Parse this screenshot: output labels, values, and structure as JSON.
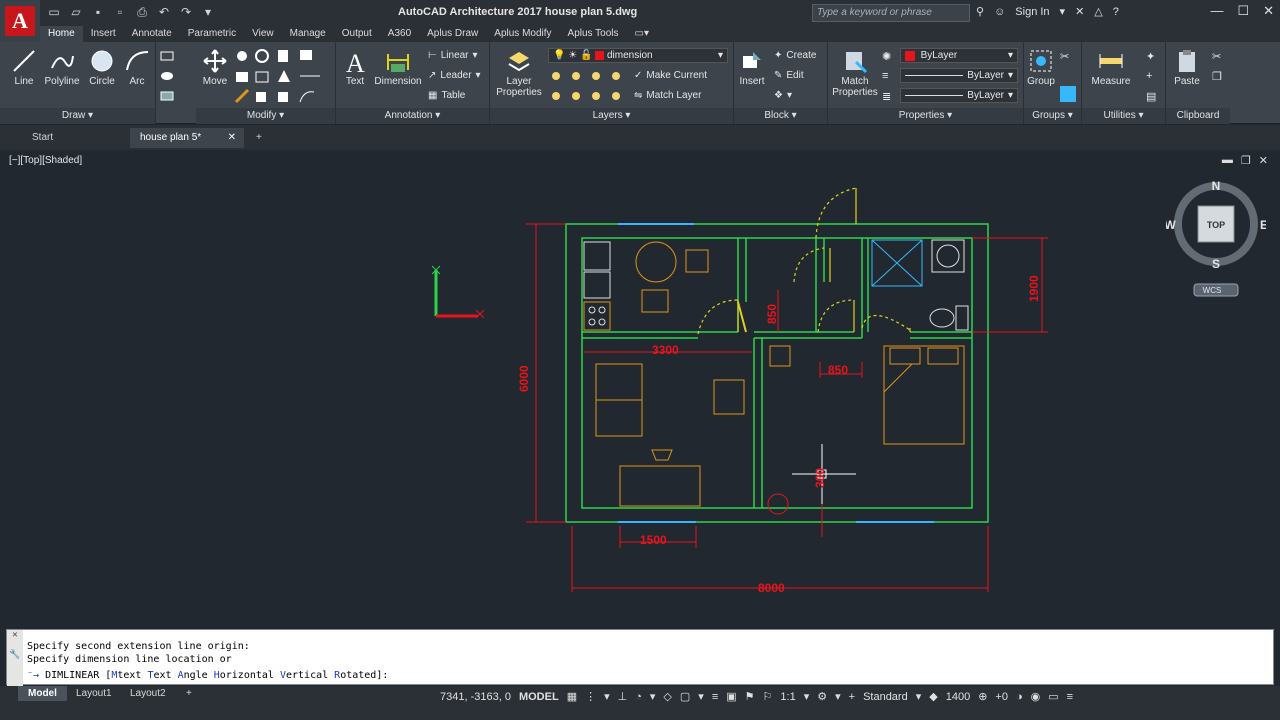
{
  "window": {
    "title": "AutoCAD Architecture 2017   house plan 5.dwg",
    "search_placeholder": "Type a keyword or phrase",
    "sign_in": "Sign In"
  },
  "ribbon_tabs": [
    "Home",
    "Insert",
    "Annotate",
    "Parametric",
    "View",
    "Manage",
    "Output",
    "A360",
    "Aplus Draw",
    "Aplus Modify",
    "Aplus Tools"
  ],
  "ribbon": {
    "draw": {
      "title": "Draw",
      "line": "Line",
      "polyline": "Polyline",
      "circle": "Circle",
      "arc": "Arc"
    },
    "modify": {
      "title": "Modify",
      "move": "Move"
    },
    "annotation": {
      "title": "Annotation",
      "text": "Text",
      "dimension": "Dimension",
      "linear": "Linear",
      "leader": "Leader",
      "table": "Table"
    },
    "layers": {
      "title": "Layers",
      "layer_properties_1": "Layer",
      "layer_properties_2": "Properties",
      "current_layer": "dimension",
      "make_current": "Make Current",
      "match_layer": "Match Layer"
    },
    "block": {
      "title": "Block",
      "insert": "Insert",
      "create": "Create",
      "edit": "Edit"
    },
    "properties": {
      "title": "Properties",
      "match_1": "Match",
      "match_2": "Properties",
      "color": "ByLayer",
      "linetype": "ByLayer",
      "lineweight": "ByLayer"
    },
    "groups": {
      "title": "Groups",
      "group": "Group"
    },
    "utilities": {
      "title": "Utilities",
      "measure": "Measure"
    },
    "clipboard": {
      "title": "Clipboard",
      "paste": "Paste"
    }
  },
  "doc_tabs": {
    "start": "Start",
    "current": "house plan 5*"
  },
  "viewport": {
    "label": "[−][Top][Shaded]",
    "viewcube": {
      "n": "N",
      "s": "S",
      "e": "E",
      "w": "W",
      "top": "TOP",
      "wcs": "WCS"
    }
  },
  "dimensions": {
    "overall_width": "8000",
    "overall_height": "6000",
    "right_1900": "1900",
    "d3300": "3300",
    "d850a": "850",
    "d850b": "850",
    "d1500": "1500",
    "d300": "300"
  },
  "command": {
    "history_1": "Specify second extension line origin:",
    "history_2": "Specify dimension line location or",
    "prompt_cmd": "DIMLINEAR [",
    "opt_m": "M",
    "opt_m_rest": "text ",
    "opt_t": "T",
    "opt_t_rest": "ext ",
    "opt_a": "A",
    "opt_a_rest": "ngle ",
    "opt_h": "H",
    "opt_h_rest": "orizontal ",
    "opt_v": "V",
    "opt_v_rest": "ertical ",
    "opt_r": "R",
    "opt_r_rest": "otated",
    "prompt_end": "]:"
  },
  "status": {
    "layouts": [
      "Model",
      "Layout1",
      "Layout2"
    ],
    "coords": "7341, -3163, 0",
    "space": "MODEL",
    "scale": "1:1",
    "style": "Standard",
    "value": "1400",
    "offset": "+0"
  },
  "colors": {
    "wall": "#2fd44a",
    "dim": "#e8141c",
    "furniture": "#e0941c",
    "fixture": "#e0e0e0",
    "window": "#36b8ff",
    "door": "#e0d21c"
  }
}
